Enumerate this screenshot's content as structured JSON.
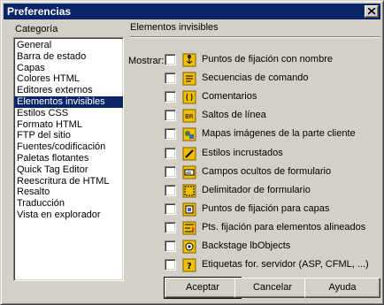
{
  "window": {
    "title": "Preferencias"
  },
  "left_panel": {
    "label": "Categoría",
    "items": [
      {
        "label": "General",
        "selected": false
      },
      {
        "label": "Barra de estado",
        "selected": false
      },
      {
        "label": "Capas",
        "selected": false
      },
      {
        "label": "Colores HTML",
        "selected": false
      },
      {
        "label": "Editores externos",
        "selected": false
      },
      {
        "label": "Elementos invisibles",
        "selected": true
      },
      {
        "label": "Estilos CSS",
        "selected": false
      },
      {
        "label": "Formato HTML",
        "selected": false
      },
      {
        "label": "FTP del sitio",
        "selected": false
      },
      {
        "label": "Fuentes/codificación",
        "selected": false
      },
      {
        "label": "Paletas flotantes",
        "selected": false
      },
      {
        "label": "Quick Tag Editor",
        "selected": false
      },
      {
        "label": "Reescritura de HTML",
        "selected": false
      },
      {
        "label": "Resalto",
        "selected": false
      },
      {
        "label": "Traducción",
        "selected": false
      },
      {
        "label": "Vista en explorador",
        "selected": false
      }
    ]
  },
  "right_panel": {
    "section_title": "Elementos invisibles",
    "show_label": "Mostrar:",
    "options": [
      {
        "label": "Puntos de fijación con nombre",
        "icon": "anchor-icon",
        "checked": false
      },
      {
        "label": "Secuencias de comando",
        "icon": "script-icon",
        "checked": false
      },
      {
        "label": "Comentarios",
        "icon": "comment-icon",
        "checked": false
      },
      {
        "label": "Saltos de línea",
        "icon": "line-break-icon",
        "checked": false
      },
      {
        "label": "Mapas imágenes de la parte cliente",
        "icon": "image-map-icon",
        "checked": false
      },
      {
        "label": "Estilos incrustados",
        "icon": "embedded-style-icon",
        "checked": false
      },
      {
        "label": "Campos ocultos de formulario",
        "icon": "hidden-field-icon",
        "checked": false
      },
      {
        "label": "Delimitador de formulario",
        "icon": "form-delimiter-icon",
        "checked": false
      },
      {
        "label": "Puntos de fijación para capas",
        "icon": "layer-anchor-icon",
        "checked": false
      },
      {
        "label": "Pts. fijación para elementos alineados",
        "icon": "aligned-anchor-icon",
        "checked": false
      },
      {
        "label": "Backstage lbObjects",
        "icon": "backstage-icon",
        "checked": false
      },
      {
        "label": "Etiquetas for. servidor (ASP, CFML, ...)",
        "icon": "server-tag-icon",
        "checked": false
      }
    ]
  },
  "buttons": {
    "accept": "Aceptar",
    "cancel": "Cancelar",
    "help": "Ayuda"
  }
}
